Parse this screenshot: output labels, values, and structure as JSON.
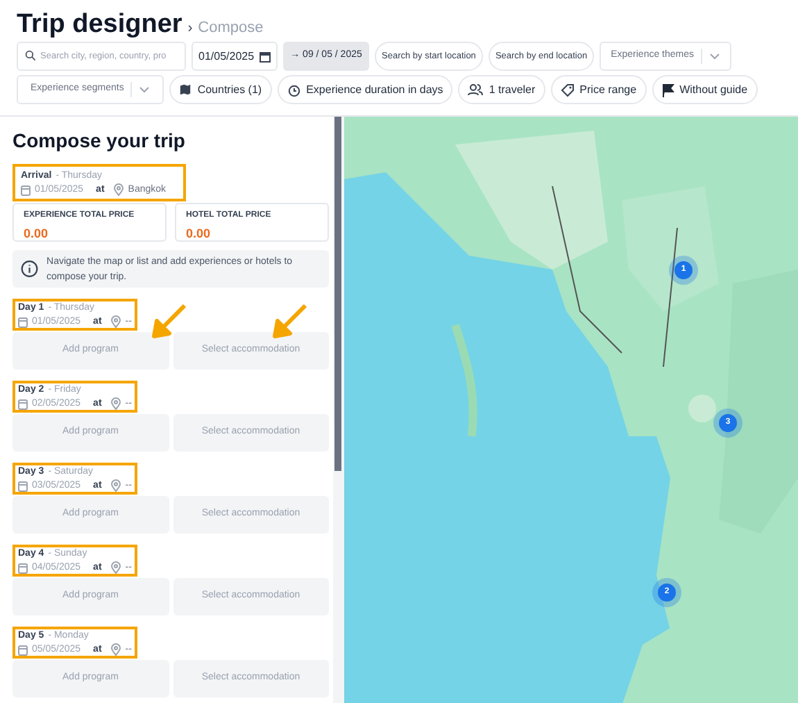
{
  "header": {
    "title": "Trip designer",
    "separator": "›",
    "breadcrumb": "Compose"
  },
  "filters_row_1": [
    {
      "kind": "search",
      "placeholder": "Search city, region, country, pro"
    },
    {
      "kind": "date",
      "value": "01/05/2025"
    },
    {
      "kind": "range",
      "label": "→ 09 / 05 / 2025"
    },
    {
      "kind": "pill",
      "placeholder": "Search by start location"
    },
    {
      "kind": "pill",
      "placeholder": "Search by end location"
    },
    {
      "kind": "select",
      "label": "Experience themes"
    }
  ],
  "filters_row_2": [
    {
      "kind": "select",
      "label": "Experience segments"
    },
    {
      "kind": "chip",
      "label": "Countries (1)"
    },
    {
      "kind": "chip",
      "label": "Experience duration in days"
    },
    {
      "kind": "chip",
      "label": "1 traveler"
    },
    {
      "kind": "chip",
      "label": "Price range"
    },
    {
      "kind": "chip",
      "label": "Without guide"
    }
  ],
  "panel": {
    "title": "Compose your trip",
    "arrival": {
      "label": "Arrival",
      "weekday": "- Thursday",
      "date": "01/05/2025",
      "at": "at",
      "place": "Bangkok",
      "highlighted": true
    },
    "prices": [
      {
        "label": "EXPERIENCE TOTAL PRICE",
        "value": "0.00"
      },
      {
        "label": "HOTEL TOTAL PRICE",
        "value": "0.00"
      }
    ],
    "info": "Navigate the map or list and add experiences or hotels to compose your trip.",
    "days": [
      {
        "label": "Day 1",
        "weekday": "- Thursday",
        "date": "01/05/2025",
        "at": "at",
        "place": "--",
        "highlighted": true,
        "arrows": true,
        "program": "Add program",
        "accommodation": "Select accommodation"
      },
      {
        "label": "Day 2",
        "weekday": "- Friday",
        "date": "02/05/2025",
        "at": "at",
        "place": "--",
        "highlighted": true,
        "arrows": false,
        "program": "Add program",
        "accommodation": "Select accommodation"
      },
      {
        "label": "Day 3",
        "weekday": "- Saturday",
        "date": "03/05/2025",
        "at": "at",
        "place": "--",
        "highlighted": true,
        "arrows": false,
        "program": "Add program",
        "accommodation": "Select accommodation"
      },
      {
        "label": "Day 4",
        "weekday": "- Sunday",
        "date": "04/05/2025",
        "at": "at",
        "place": "--",
        "highlighted": true,
        "arrows": false,
        "program": "Add program",
        "accommodation": "Select accommodation"
      },
      {
        "label": "Day 5",
        "weekday": "- Monday",
        "date": "05/05/2025",
        "at": "at",
        "place": "--",
        "highlighted": true,
        "arrows": false,
        "program": "Add program",
        "accommodation": "Select accommodation"
      }
    ]
  },
  "map": {
    "kind": "picture",
    "markers": [
      {
        "count": "1"
      },
      {
        "count": "3"
      },
      {
        "count": "2"
      }
    ]
  }
}
